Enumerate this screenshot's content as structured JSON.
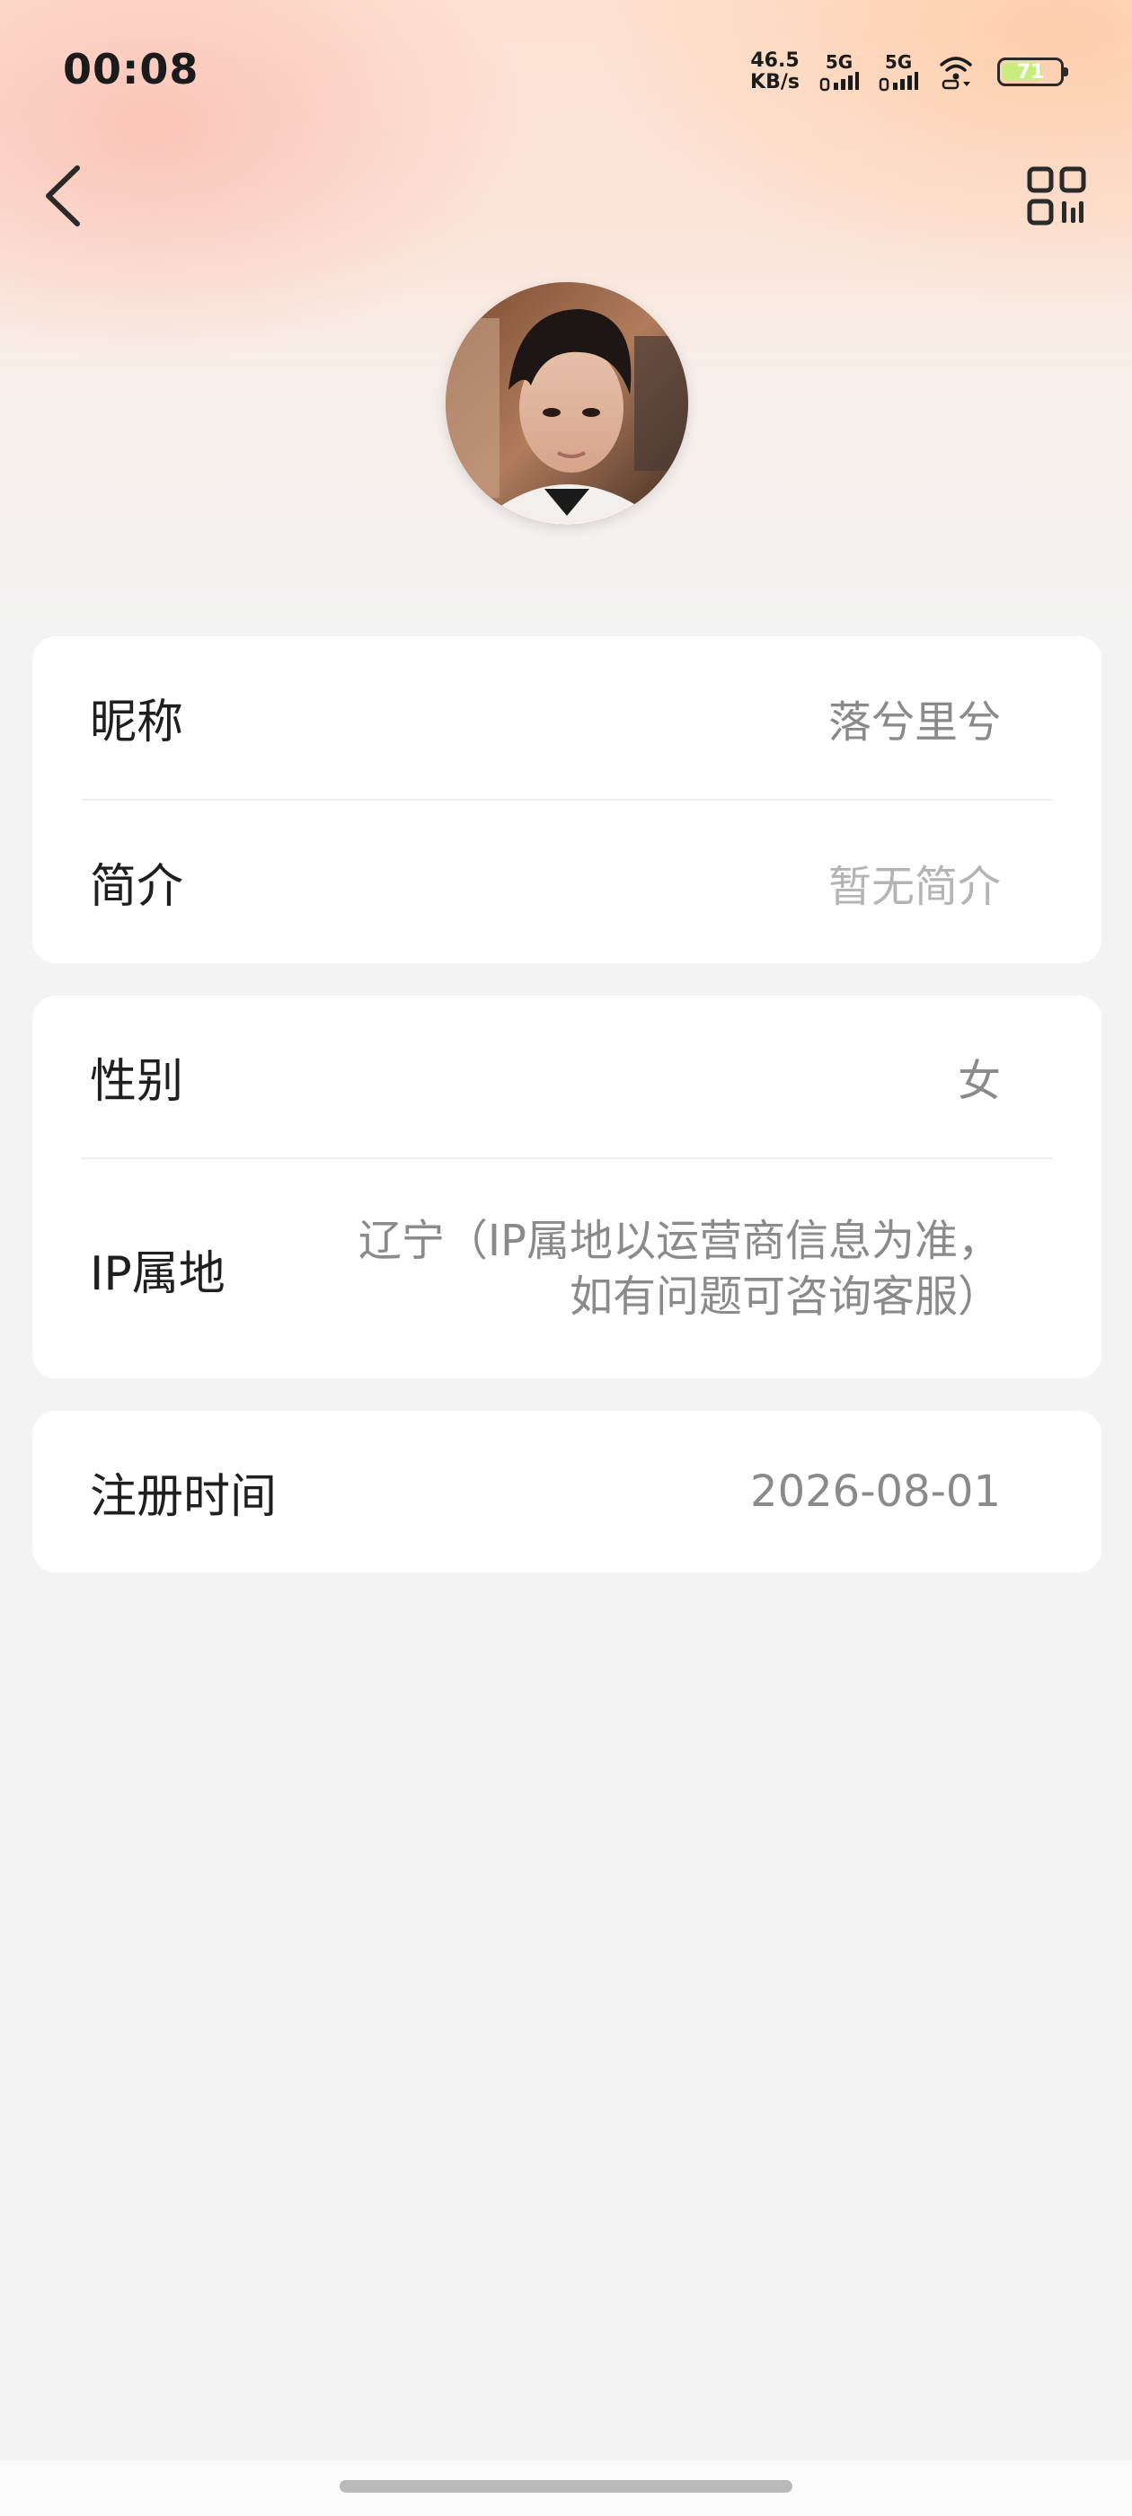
{
  "status_bar": {
    "time": "00:08",
    "net_speed_value": "46.5",
    "net_speed_unit": "KB/s",
    "sim1_label": "5G",
    "sim2_label": "5G",
    "battery_level": "71",
    "battery_fraction": 0.71,
    "battery_color": "#c9ec7e"
  },
  "nav": {
    "back_icon": "chevron-left-icon",
    "qr_icon": "qr-code-icon"
  },
  "profile": {
    "avatar_icon": "user-avatar"
  },
  "card1": {
    "nickname_label": "昵称",
    "nickname_value": "落兮里兮",
    "bio_label": "简介",
    "bio_value": "暂无简介"
  },
  "card2": {
    "gender_label": "性别",
    "gender_value": "女",
    "ip_label": "IP属地",
    "ip_value_line1": "辽宁（IP属地以运营商信息为准，",
    "ip_value_line2": "如有问题可咨询客服）"
  },
  "card3": {
    "register_label": "注册时间",
    "register_value": "2026-08-01"
  }
}
